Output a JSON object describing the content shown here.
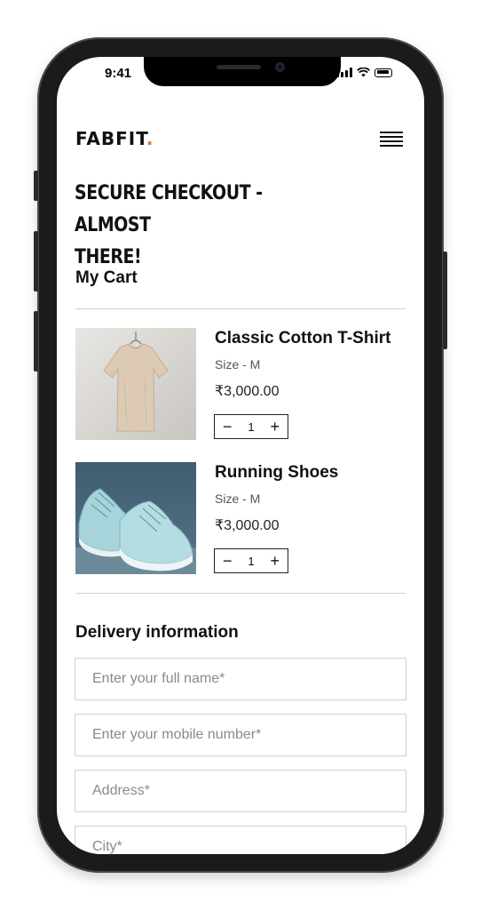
{
  "status_bar": {
    "time": "9:41"
  },
  "header": {
    "logo_text": "FABFIT",
    "logo_dot": ".",
    "accent_color": "#e07a2e",
    "menu_icon": "hamburger-menu-icon"
  },
  "page": {
    "headline_line1": "SECURE CHECKOUT - ALMOST",
    "headline_line2": "THERE!"
  },
  "cart": {
    "title": "My Cart",
    "items": [
      {
        "name": "Classic Cotton T-Shirt",
        "size": "Size - M",
        "price": "₹3,000.00",
        "quantity": "1",
        "minus": "−",
        "plus": "+",
        "image": "beige t-shirt on hanger"
      },
      {
        "name": "Running Shoes",
        "size": "Size - M",
        "price": "₹3,000.00",
        "quantity": "1",
        "minus": "−",
        "plus": "+",
        "image": "light blue running shoes"
      }
    ]
  },
  "delivery": {
    "title": "Delivery information",
    "fields": [
      {
        "placeholder": "Enter your full name*"
      },
      {
        "placeholder": "Enter your mobile number*"
      },
      {
        "placeholder": "Address*"
      },
      {
        "placeholder": "City*"
      }
    ]
  }
}
